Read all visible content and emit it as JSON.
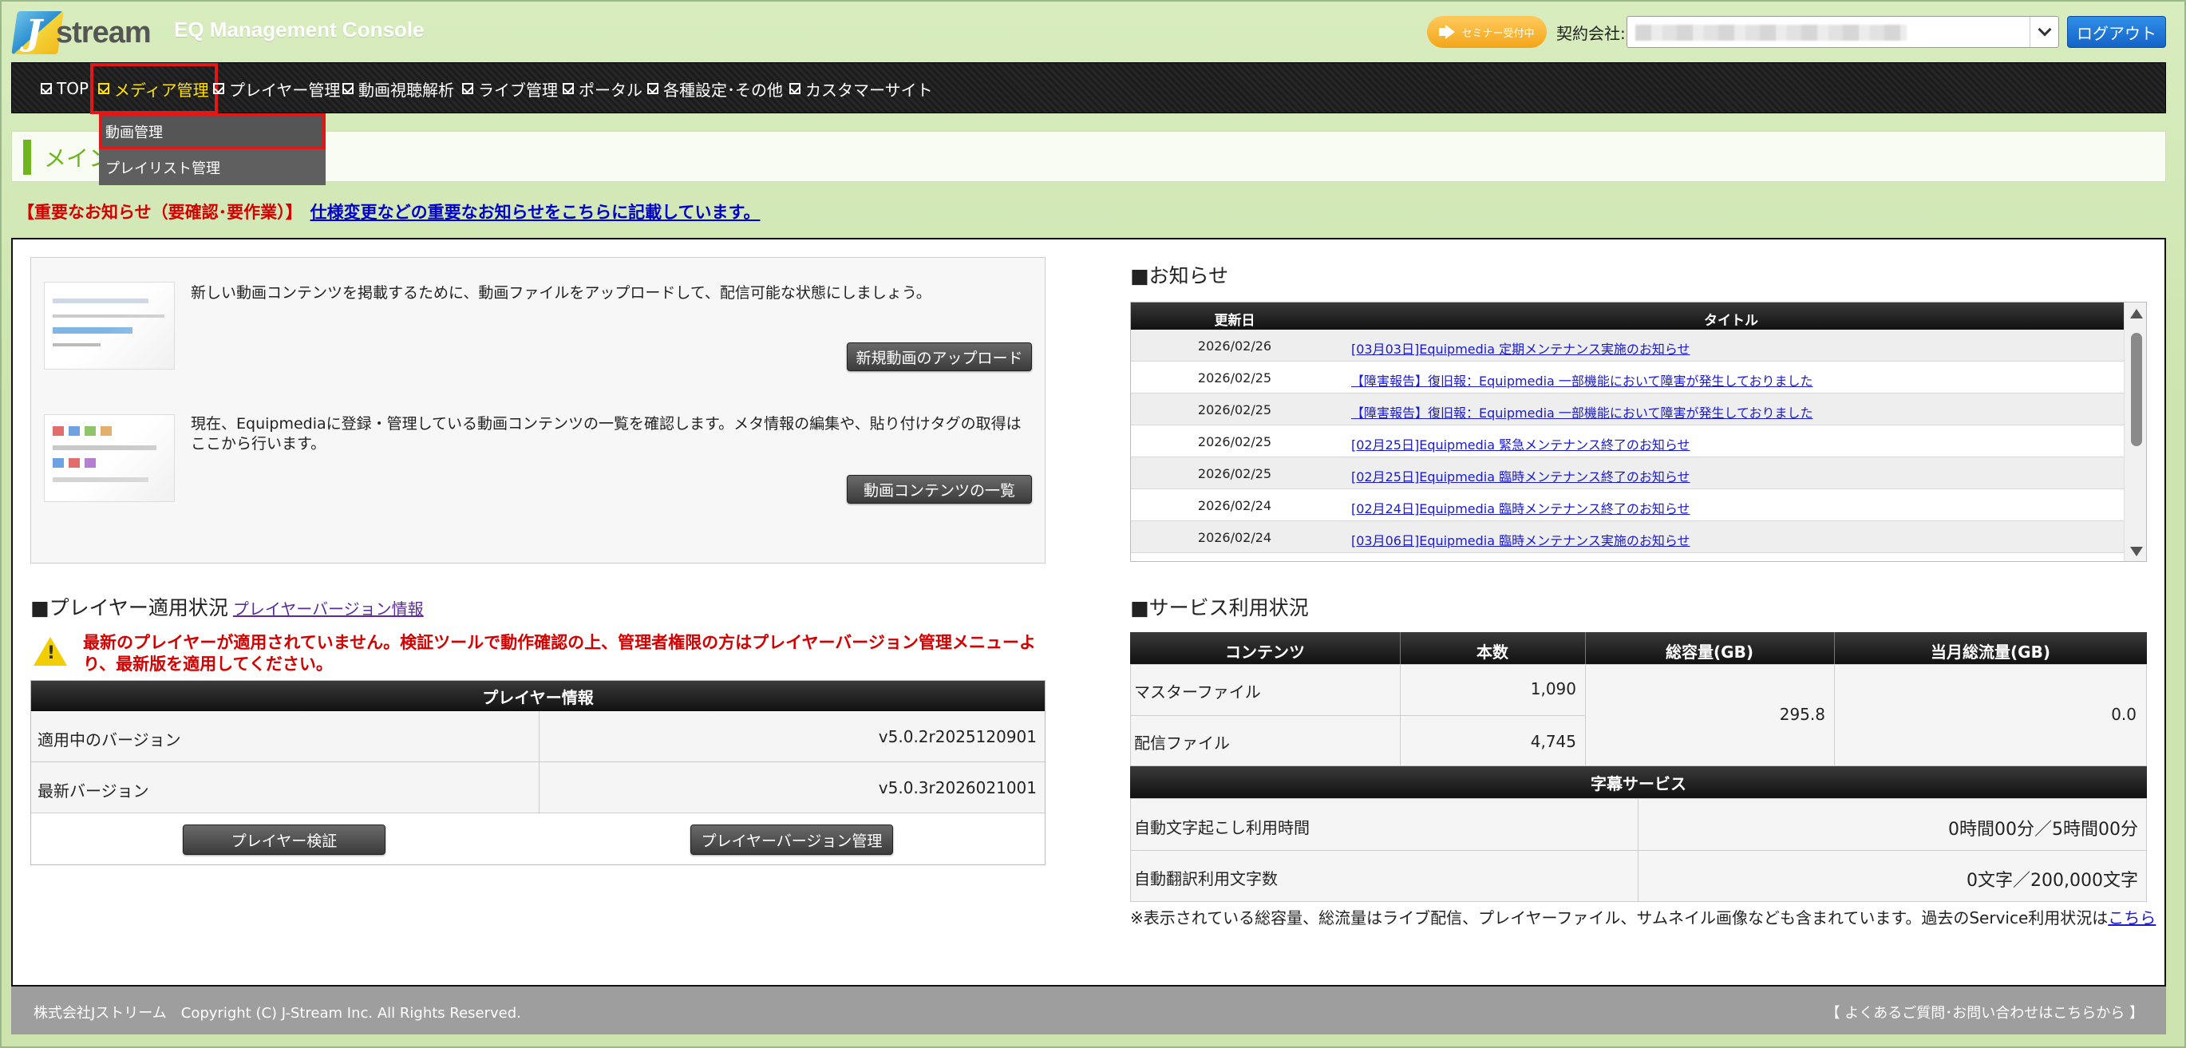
{
  "header": {
    "logo_text": "stream",
    "logo_initial": "J",
    "app_title": "EQ Management Console",
    "seminar_badge": "セミナー受付中",
    "contract_label": "契約会社:",
    "logout_label": "ログアウト"
  },
  "nav": {
    "items": [
      {
        "label": "TOP"
      },
      {
        "label": "メディア管理"
      },
      {
        "label": "プレイヤー管理"
      },
      {
        "label": "動画視聴解析"
      },
      {
        "label": "ライブ管理"
      },
      {
        "label": "ポータル"
      },
      {
        "label": "各種設定･その他"
      },
      {
        "label": "カスタマーサイト"
      }
    ],
    "dropdown": [
      {
        "label": "動画管理"
      },
      {
        "label": "プレイリスト管理"
      }
    ]
  },
  "title_bar": {
    "text": "メイン"
  },
  "notice": {
    "prefix": "【重要なお知らせ（要確認･要作業）】",
    "link": "仕様変更などの重要なお知らせをこちらに記載しています。"
  },
  "media": {
    "upload_desc": "新しい動画コンテンツを掲載するために、動画ファイルをアップロードして、配信可能な状態にしましょう。",
    "upload_button": "新規動画のアップロード",
    "list_desc": "現在、Equipmediaに登録・管理している動画コンテンツの一覧を確認します。メタ情報の編集や、貼り付けタグの取得はここから行います。",
    "list_button": "動画コンテンツの一覧"
  },
  "player": {
    "section_title": "■プレイヤー適用状況",
    "version_link": "プレイヤーバージョン情報",
    "warning": "最新のプレイヤーが適用されていません。検証ツールで動作確認の上、管理者権限の方はプレイヤーバージョン管理メニューより、最新版を適用してください。",
    "info_title": "プレイヤー情報",
    "rows": [
      {
        "label": "適用中のバージョン",
        "value": "v5.0.2r2025120901"
      },
      {
        "label": "最新バージョン",
        "value": "v5.0.3r2026021001"
      }
    ],
    "verify_button": "プレイヤー検証",
    "manage_button": "プレイヤーバージョン管理"
  },
  "news": {
    "section_title": "■お知らせ",
    "col_date": "更新日",
    "col_title": "タイトル",
    "rows": [
      {
        "date": "2026/02/26",
        "title": "[03月03日]Equipmedia 定期メンテナンス実施のお知らせ"
      },
      {
        "date": "2026/02/25",
        "title": "【障害報告】復旧報：Equipmedia 一部機能において障害が発生しておりました"
      },
      {
        "date": "2026/02/25",
        "title": "【障害報告】復旧報：Equipmedia 一部機能において障害が発生しておりました"
      },
      {
        "date": "2026/02/25",
        "title": "[02月25日]Equipmedia 緊急メンテナンス終了のお知らせ"
      },
      {
        "date": "2026/02/25",
        "title": "[02月25日]Equipmedia 臨時メンテナンス終了のお知らせ"
      },
      {
        "date": "2026/02/24",
        "title": "[02月24日]Equipmedia 臨時メンテナンス終了のお知らせ"
      },
      {
        "date": "2026/02/24",
        "title": "[03月06日]Equipmedia 臨時メンテナンス実施のお知らせ"
      }
    ]
  },
  "service": {
    "section_title": "■サービス利用状況",
    "headers": [
      "コンテンツ",
      "本数",
      "総容量(GB)",
      "当月総流量(GB)"
    ],
    "rows": [
      {
        "label": "マスターファイル",
        "count": "1,090"
      },
      {
        "label": "配信ファイル",
        "count": "4,745"
      }
    ],
    "total_capacity": "295.8",
    "monthly_traffic": "0.0",
    "subtitle_title": "字幕サービス",
    "subtitle_rows": [
      {
        "label": "自動文字起こし利用時間",
        "value": "0時間00分／5時間00分"
      },
      {
        "label": "自動翻訳利用文字数",
        "value": "0文字／200,000文字"
      }
    ],
    "note": "※表示されている総容量、総流量はライブ配信、プレイヤーファイル、サムネイル画像なども含まれています。過去のService利用状況は",
    "note_link": "こちら"
  },
  "footer": {
    "copyright": "株式会社Jストリーム　Copyright (C) J-Stream Inc. All Rights Reserved.",
    "help": "【 よくあるご質問･お問い合わせはこちらから 】"
  },
  "colors": {
    "accent_green": "#6fb51f",
    "nav_active": "#ffe000",
    "highlight_red": "#e21818",
    "link_blue": "#1a1acc",
    "warning_red": "#d30000"
  }
}
